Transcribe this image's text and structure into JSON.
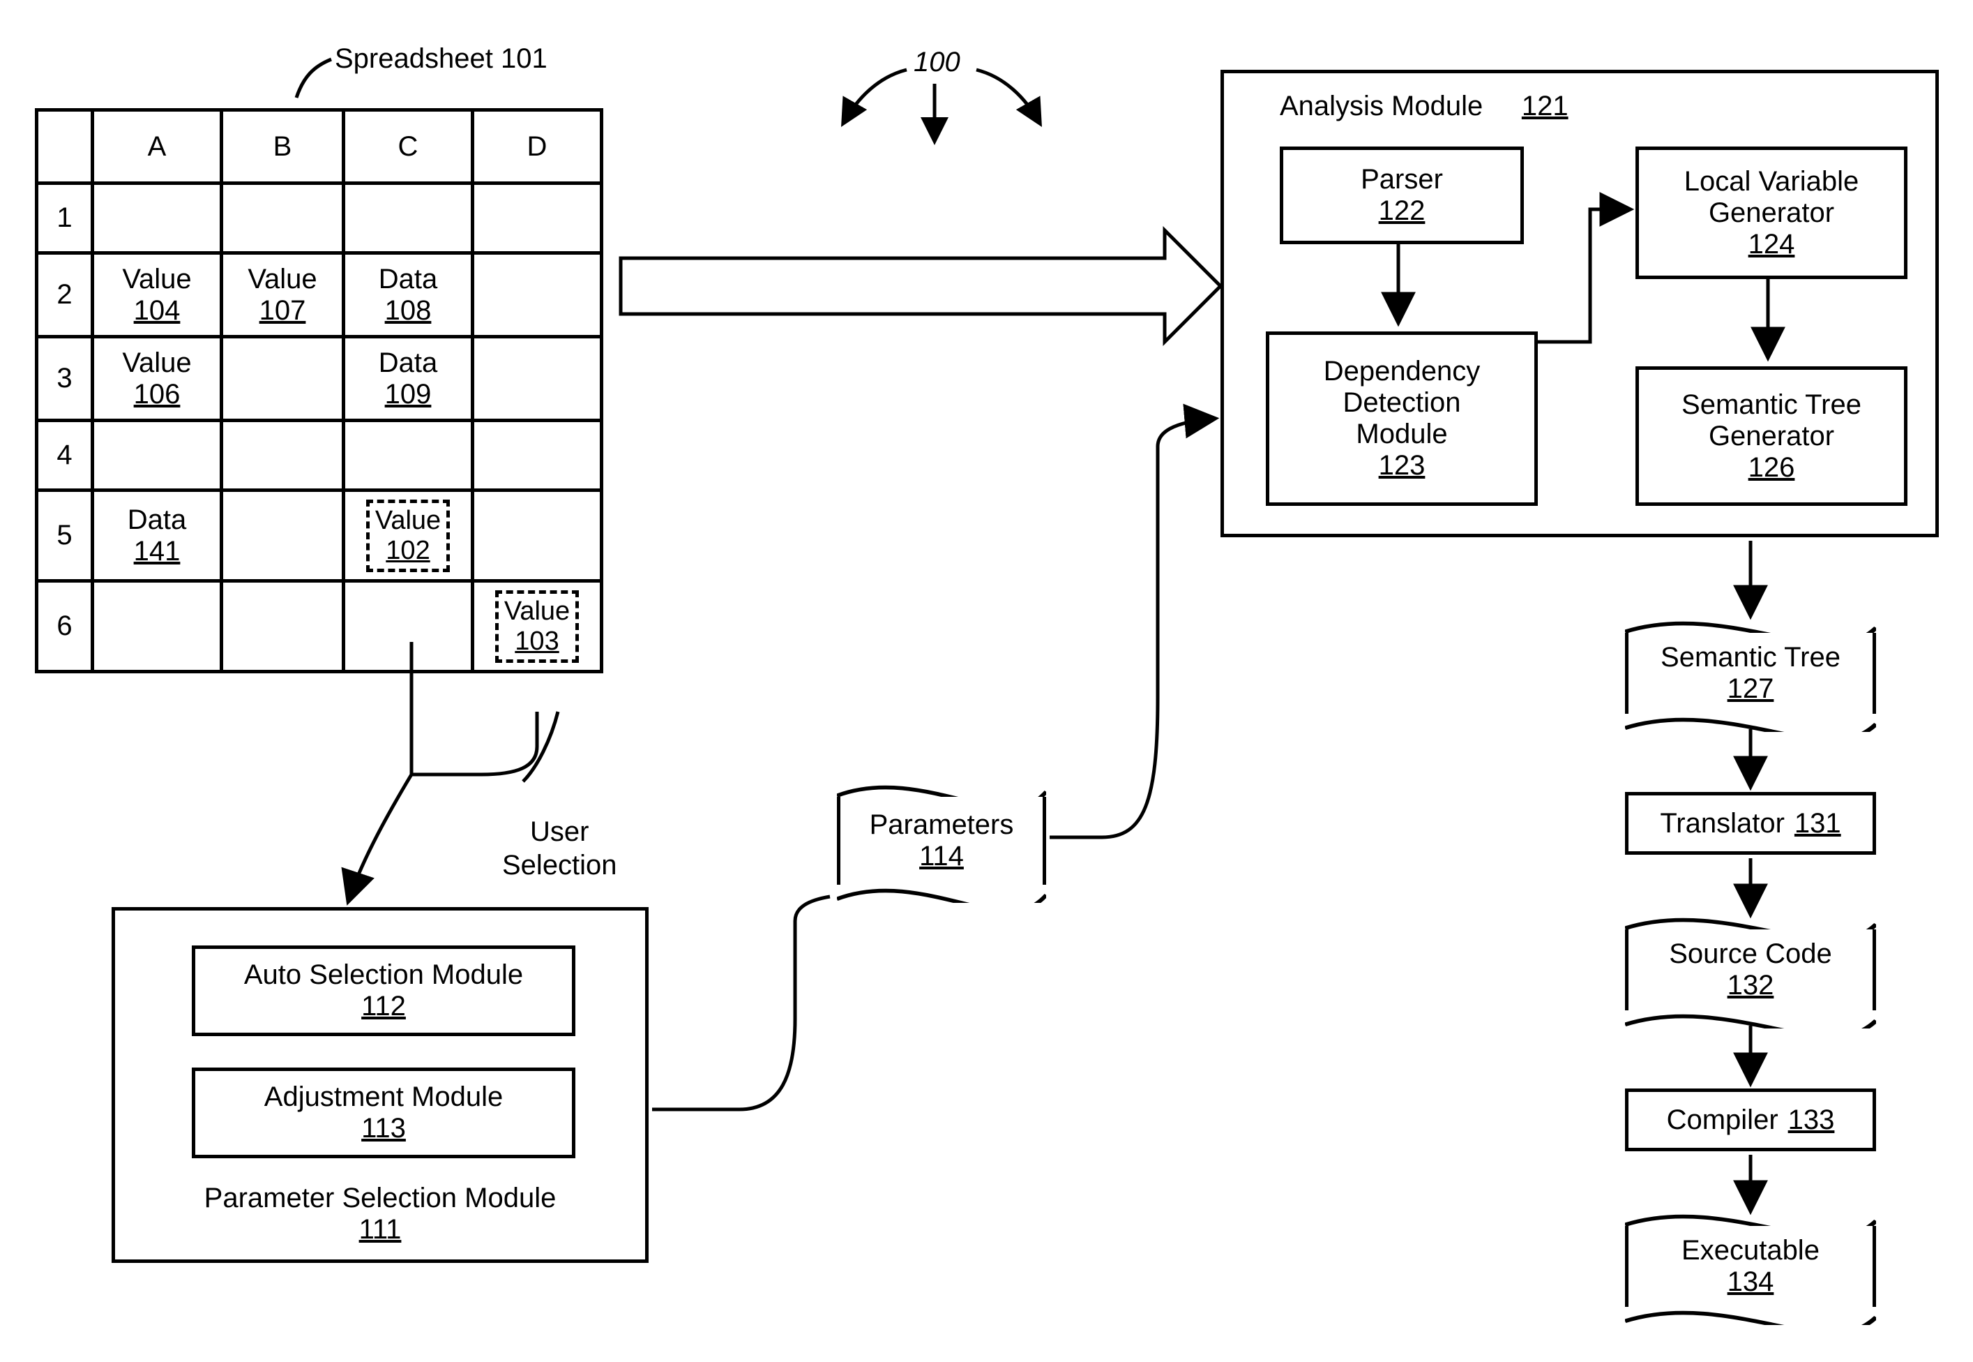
{
  "figure_ref": "100",
  "spreadsheet": {
    "title": "Spreadsheet 101",
    "columns": [
      "A",
      "B",
      "C",
      "D"
    ],
    "rows": [
      "1",
      "2",
      "3",
      "4",
      "5",
      "6"
    ],
    "cells": {
      "A2": {
        "label": "Value",
        "ref": "104"
      },
      "B2": {
        "label": "Value",
        "ref": "107"
      },
      "C2": {
        "label": "Data",
        "ref": "108"
      },
      "A3": {
        "label": "Value",
        "ref": "106"
      },
      "C3": {
        "label": "Data",
        "ref": "109"
      },
      "A5": {
        "label": "Data",
        "ref": "141"
      },
      "C5": {
        "label": "Value",
        "ref": "102",
        "dashed": true
      },
      "D6": {
        "label": "Value",
        "ref": "103",
        "dashed": true
      }
    },
    "user_selection_label": "User\nSelection"
  },
  "psm": {
    "title": "Parameter Selection Module",
    "ref": "111",
    "auto": {
      "title": "Auto Selection Module",
      "ref": "112"
    },
    "adj": {
      "title": "Adjustment Module",
      "ref": "113"
    }
  },
  "parameters": {
    "title": "Parameters",
    "ref": "114"
  },
  "analysis": {
    "title": "Analysis Module",
    "ref": "121",
    "parser": {
      "title": "Parser",
      "ref": "122"
    },
    "dep": {
      "title": "Dependency Detection Module",
      "ref": "123"
    },
    "localvar": {
      "title": "Local Variable Generator",
      "ref": "124"
    },
    "semgen": {
      "title": "Semantic Tree Generator",
      "ref": "126"
    }
  },
  "pipeline": {
    "semtree": {
      "title": "Semantic Tree",
      "ref": "127"
    },
    "translator": {
      "title": "Translator",
      "ref": "131"
    },
    "source": {
      "title": "Source Code",
      "ref": "132"
    },
    "compiler": {
      "title": "Compiler",
      "ref": "133"
    },
    "exe": {
      "title": "Executable",
      "ref": "134"
    }
  }
}
